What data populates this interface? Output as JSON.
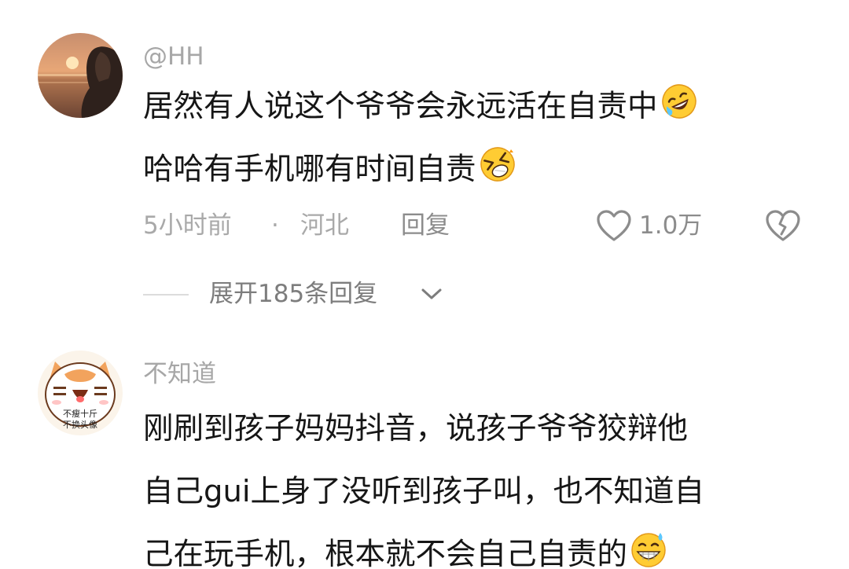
{
  "comments": [
    {
      "username": "@HH",
      "lines": [
        {
          "text": "居然有人说这个爷爷会永远活在自责中",
          "emoji": "rofl-emoji"
        },
        {
          "text": "哈哈有手机哪有时间自责",
          "emoji": "xd-laughing-emoji"
        }
      ],
      "time": "5小时前",
      "separator": "·",
      "location": "河北",
      "reply_label": "回复",
      "like_count": "1.0万",
      "expand_label": "展开185条回复"
    },
    {
      "username": "不知道",
      "avatar_text": [
        "不瘦十斤",
        "不换头像"
      ],
      "lines": [
        {
          "text": "刚刷到孩子妈妈抖音，说孩子爷爷狡辩他"
        },
        {
          "text": "自己gui上身了没听到孩子叫，也不知道自"
        },
        {
          "text": "己在玩手机，根本就不会自己自责的",
          "emoji": "grin-sweat-emoji"
        }
      ]
    }
  ],
  "colors": {
    "username": "#a7a7a7",
    "body_text": "#161616",
    "meta": "#a9a9a9",
    "emoji_yellow": "#ffcc33"
  },
  "icons": [
    "heart-outline-icon",
    "broken-heart-icon",
    "chevron-down-icon"
  ]
}
